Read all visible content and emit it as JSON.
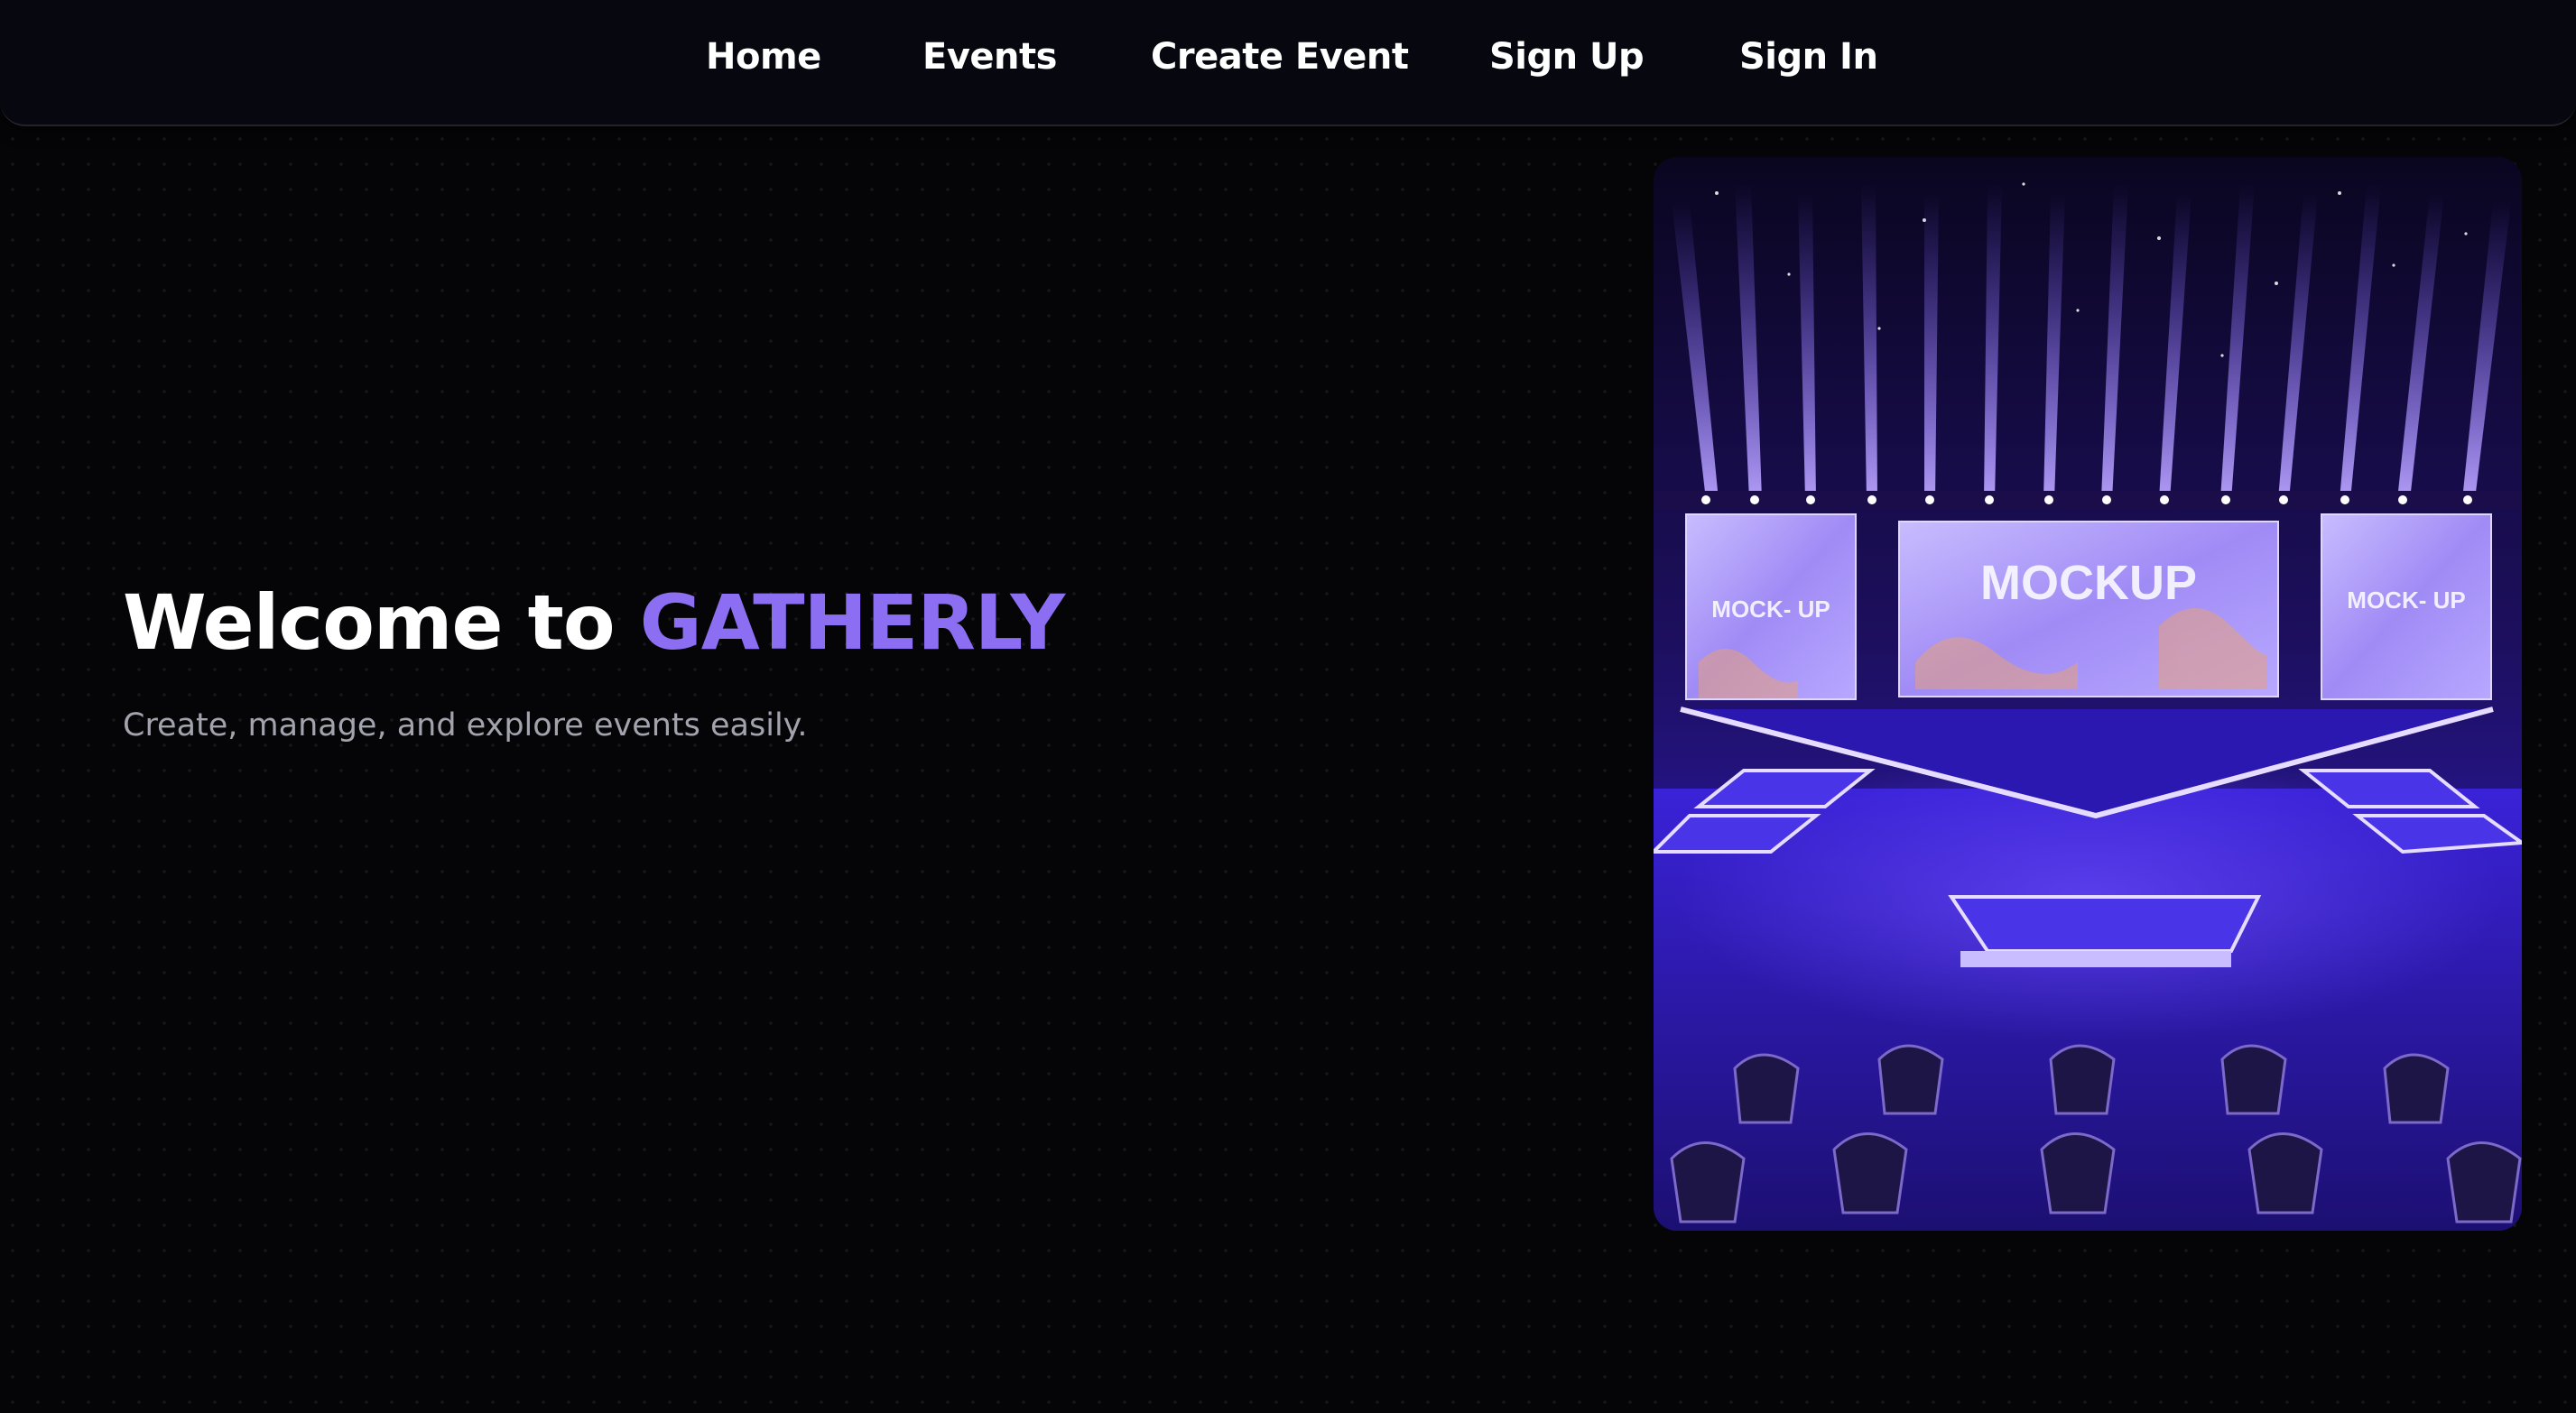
{
  "nav": {
    "home": "Home",
    "events": "Events",
    "create_event": "Create Event",
    "sign_up": "Sign Up",
    "sign_in": "Sign In"
  },
  "hero": {
    "title_prefix": "Welcome to",
    "brand": "GATHERLY",
    "subtitle": "Create, manage, and explore events easily.",
    "image": {
      "center_screen_text": "MOCKUP",
      "left_screen_text": "MOCK- UP",
      "right_screen_text": "MOCK- UP"
    }
  },
  "colors": {
    "background": "#050507",
    "navbar": "#07070f",
    "brand_accent": "#8c6ef2",
    "subtitle": "#a3a3ad"
  }
}
